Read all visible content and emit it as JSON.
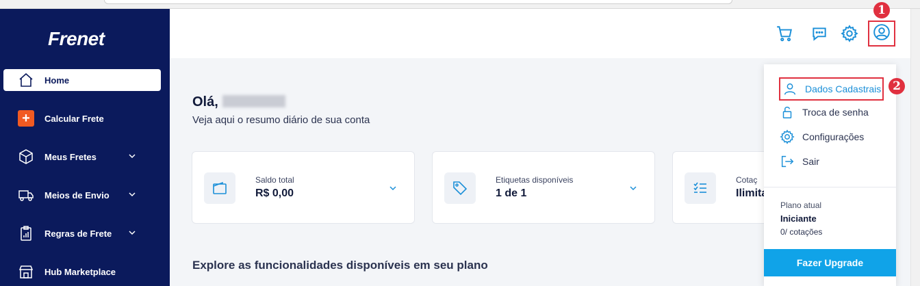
{
  "app": {
    "logo": "Frenet"
  },
  "sidebar": {
    "items": [
      {
        "label": "Home",
        "icon": "home-icon",
        "active": true
      },
      {
        "label": "Calcular Frete",
        "icon": "plus-icon"
      },
      {
        "label": "Meus Fretes",
        "icon": "box-icon",
        "expandable": true
      },
      {
        "label": "Meios de Envio",
        "icon": "truck-icon",
        "expandable": true
      },
      {
        "label": "Regras de Frete",
        "icon": "clipboard-chart-icon",
        "expandable": true
      },
      {
        "label": "Hub Marketplace",
        "icon": "store-icon"
      }
    ]
  },
  "header": {
    "icons": [
      "cart-icon",
      "chat-icon",
      "settings-icon",
      "user-icon"
    ],
    "annotation_1": "1"
  },
  "main": {
    "greeting": "Olá,",
    "subtitle": "Veja aqui o resumo diário de sua conta",
    "cards": [
      {
        "label": "Saldo total",
        "value": "R$ 0,00",
        "icon": "wallet-icon"
      },
      {
        "label": "Etiquetas disponíveis",
        "value": "1 de 1",
        "icon": "tag-icon"
      },
      {
        "label": "Cotaç",
        "value": "Ilimita",
        "icon": "list-icon"
      }
    ],
    "explore": "Explore as funcionalidades disponíveis em seu plano"
  },
  "dropdown": {
    "items": [
      {
        "label": "Dados Cadastrais",
        "icon": "user-icon"
      },
      {
        "label": "Troca de senha",
        "icon": "lock-icon"
      },
      {
        "label": "Configurações",
        "icon": "settings-icon"
      },
      {
        "label": "Sair",
        "icon": "logout-icon"
      }
    ],
    "annotation_2": "2",
    "plan_label": "Plano atual",
    "plan_name": "Iniciante",
    "plan_quota": "0/ cotações",
    "upgrade_label": "Fazer Upgrade"
  },
  "colors": {
    "sidebar": "#0b1a5c",
    "accent": "#10a3e8",
    "annotation": "#e0303f",
    "orange": "#f15a22"
  }
}
